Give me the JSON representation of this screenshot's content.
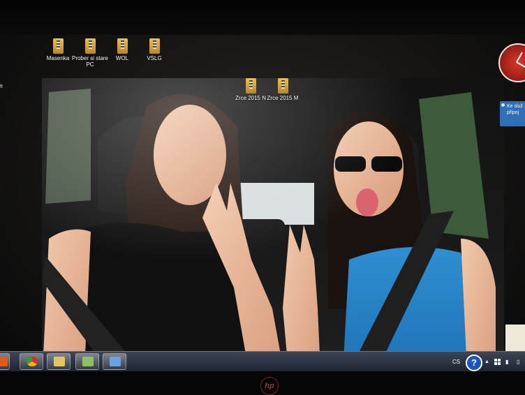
{
  "desktop_icons": [
    {
      "label": "Masenka"
    },
    {
      "label": "Prober si stare PC"
    },
    {
      "label": "WOL"
    },
    {
      "label": "VSLG"
    },
    {
      "label": "Zrce 2015 N"
    },
    {
      "label": "Zrce 2015 M"
    }
  ],
  "gadget": {
    "line1": "Ke služ",
    "line2": "připoj"
  },
  "left_edge": {
    "label": "ft"
  },
  "tray": {
    "language": "CS",
    "help": "?"
  },
  "bezel_logo": "hp",
  "taskbar_buttons": [
    {
      "name": "media-player-icon",
      "color": "#e05a18"
    },
    {
      "name": "chrome-icon",
      "color": "#2d9c3c"
    },
    {
      "name": "file-explorer-icon",
      "color": "#e4c45c"
    },
    {
      "name": "spreadsheet-icon",
      "color": "#8fc060"
    },
    {
      "name": "display-icon",
      "color": "#6aa4e0"
    }
  ],
  "colors": {
    "taskbar": "#2a3140",
    "accent": "#2f6fb5"
  }
}
